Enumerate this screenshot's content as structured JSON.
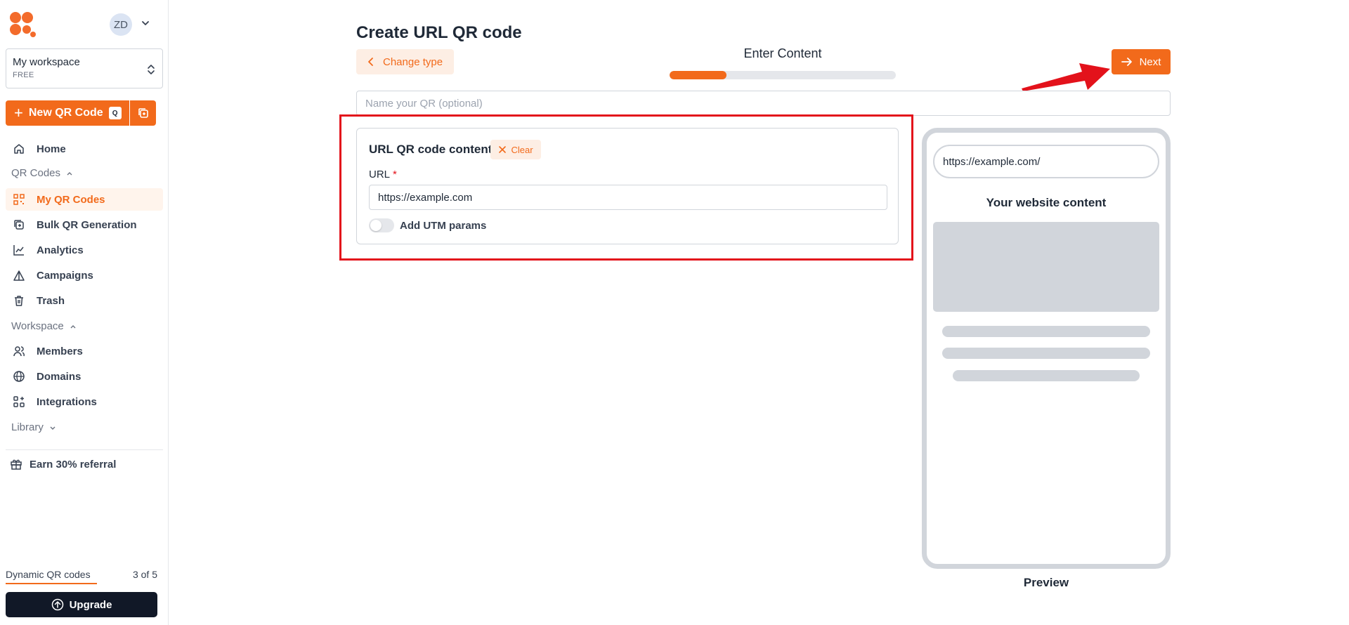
{
  "header": {
    "avatar_initials": "ZD"
  },
  "workspace": {
    "name": "My workspace",
    "plan": "FREE"
  },
  "sidebar": {
    "new_qr_label": "New QR Code",
    "new_qr_shortcut": "Q",
    "items": [
      {
        "label": "Home",
        "icon": "home-icon"
      },
      {
        "label": "My QR Codes",
        "icon": "qr-grid-icon",
        "active": true
      },
      {
        "label": "Bulk QR Generation",
        "icon": "bulk-copy-icon"
      },
      {
        "label": "Analytics",
        "icon": "analytics-icon"
      },
      {
        "label": "Campaigns",
        "icon": "campaigns-icon"
      },
      {
        "label": "Trash",
        "icon": "trash-icon"
      },
      {
        "label": "Members",
        "icon": "members-icon"
      },
      {
        "label": "Domains",
        "icon": "globe-icon"
      },
      {
        "label": "Integrations",
        "icon": "integrations-icon"
      }
    ],
    "sections": {
      "qr_codes": "QR Codes",
      "workspace": "Workspace",
      "library": "Library"
    },
    "referral": "Earn 30% referral",
    "dynamic_label": "Dynamic QR codes",
    "dynamic_count": "3 of 5",
    "dynamic_usage_fraction": 0.6,
    "upgrade": "Upgrade"
  },
  "main": {
    "title": "Create URL QR code",
    "change_type": "Change type",
    "step_label": "Enter Content",
    "step_progress_fraction": 0.25,
    "next": "Next",
    "name_placeholder": "Name your QR (optional)",
    "card_title": "URL QR code content",
    "clear": "Clear",
    "url_label": "URL",
    "url_required_mark": "*",
    "url_value": "https://example.com",
    "utm_label": "Add UTM params",
    "utm_enabled": false
  },
  "preview": {
    "url": "https://example.com/",
    "heading": "Your website content",
    "label": "Preview"
  },
  "colors": {
    "accent": "#f26a1b",
    "annotation": "#e3121b",
    "dark": "#111827"
  }
}
